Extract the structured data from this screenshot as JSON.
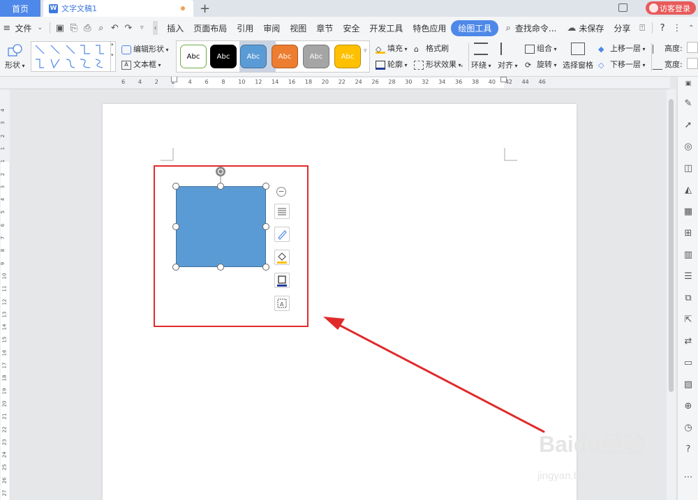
{
  "tabs": {
    "home": "首页",
    "doc_icon": "W",
    "doc_title": "文字文稿1",
    "new_tab": "+",
    "login": "访客登录"
  },
  "menu": {
    "file": "文件",
    "items": [
      "插入",
      "页面布局",
      "引用",
      "审阅",
      "视图",
      "章节",
      "安全",
      "开发工具",
      "特色应用",
      "绘图工具"
    ],
    "active_item": "绘图工具",
    "search": "查找命令...",
    "unsaved": "未保存",
    "share": "分享",
    "help": "?"
  },
  "ribbon": {
    "shape": "形状",
    "edit_shape": "编辑形状",
    "text_box": "文本框",
    "styles": [
      "Abc",
      "Abc",
      "Abc",
      "Abc",
      "Abc",
      "Abc"
    ],
    "style_colors": {
      "fill": [
        "#ffffff",
        "#000000",
        "#5b9bd5",
        "#ed7d31",
        "#a5a5a5",
        "#ffc000"
      ],
      "border": [
        "#70ad47",
        "#000000",
        "#41719c",
        "#ae5a21",
        "#787878",
        "#bc8c00"
      ],
      "text": [
        "#000000",
        "#ffffff",
        "#ffffff",
        "#ffffff",
        "#ffffff",
        "#ffffff"
      ]
    },
    "fill": "填充",
    "format_painter": "格式刷",
    "outline": "轮廓",
    "shape_effects": "形状效果",
    "wrap": "环绕",
    "align": "对齐",
    "group": "组合",
    "rotate": "旋转",
    "selection_pane": "选择窗格",
    "bring_forward": "上移一层",
    "send_backward": "下移一层",
    "height": "高度:",
    "width": "宽度:"
  },
  "ruler": {
    "h_numbers": [
      "6",
      "4",
      "2",
      "2",
      "4",
      "6",
      "8",
      "10",
      "12",
      "14",
      "16",
      "18",
      "20",
      "22",
      "24",
      "26",
      "28",
      "30",
      "32",
      "34",
      "36",
      "38",
      "40",
      "42",
      "44",
      "46"
    ],
    "v_numbers": [
      "4",
      "3",
      "2",
      "1",
      "1",
      "2",
      "3",
      "4",
      "5",
      "6",
      "7",
      "8",
      "9",
      "10",
      "11",
      "12",
      "13",
      "14",
      "15",
      "16",
      "17",
      "18",
      "19",
      "20",
      "21",
      "22",
      "23",
      "24",
      "25",
      "26",
      "27"
    ]
  },
  "canvas": {
    "shape_fill": "#5b9bd5",
    "shape_border": "#41719c",
    "highlight_color": "#e02b2b",
    "arrow_color": "#e02b2b"
  },
  "watermark": {
    "brand": "Baidu经验",
    "url": "jingyan.baidu.com"
  }
}
